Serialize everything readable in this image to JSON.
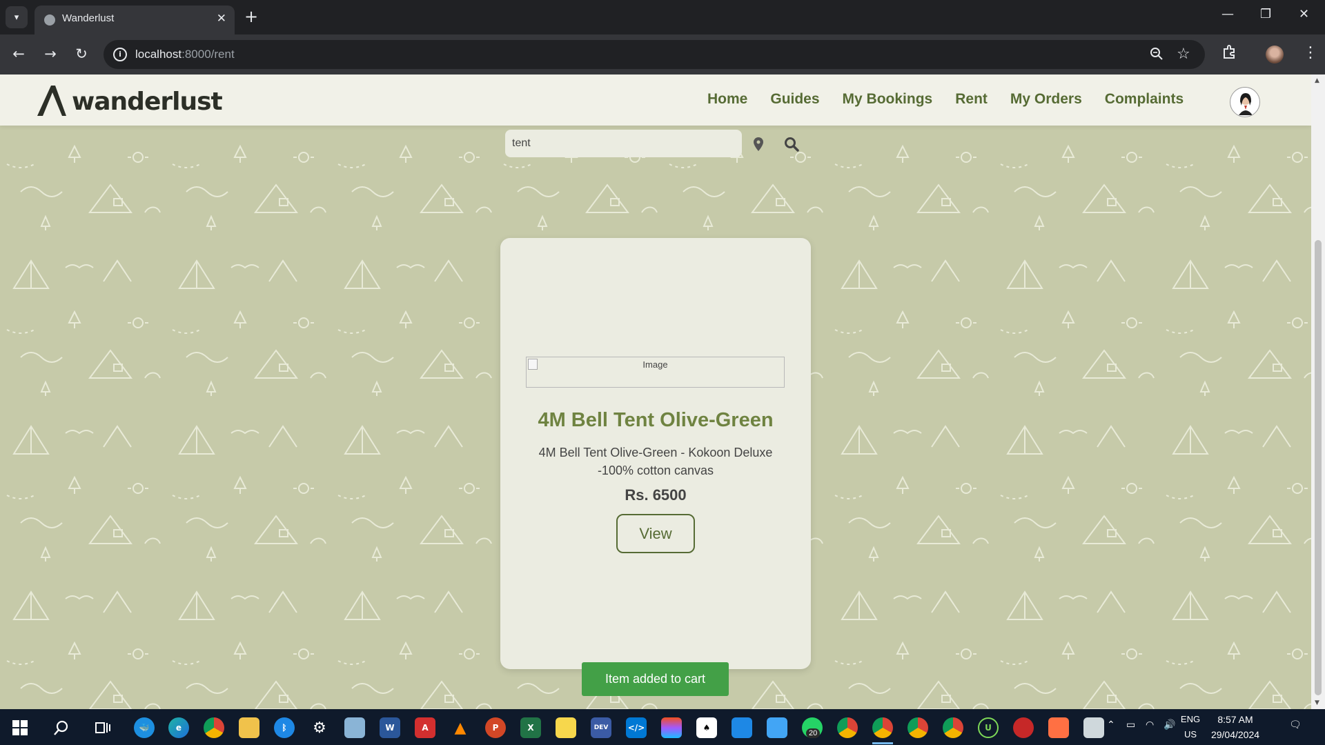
{
  "browser": {
    "tab_title": "Wanderlust",
    "url_host": "localhost",
    "url_path": ":8000/rent"
  },
  "site": {
    "logo_text": "wanderlust",
    "nav": [
      {
        "label": "Home"
      },
      {
        "label": "Guides"
      },
      {
        "label": "My Bookings"
      },
      {
        "label": "Rent"
      },
      {
        "label": "My Orders"
      },
      {
        "label": "Complaints"
      }
    ]
  },
  "search": {
    "value": "tent"
  },
  "product": {
    "image_alt": "Image",
    "name": "4M Bell Tent Olive-Green",
    "description": "4M Bell Tent Olive-Green - Kokoon Deluxe -100% cotton canvas",
    "price": "Rs. 6500",
    "view_label": "View"
  },
  "toast": {
    "message": "Item added to cart"
  },
  "taskbar": {
    "lang_line1": "ENG",
    "lang_line2": "US",
    "time": "8:57 AM",
    "date": "29/04/2024",
    "whatsapp_badge": "20"
  },
  "colors": {
    "accent": "#566b34",
    "product_title": "#6f8341",
    "page_bg": "#c6caa9",
    "toast_bg": "#43a047"
  }
}
